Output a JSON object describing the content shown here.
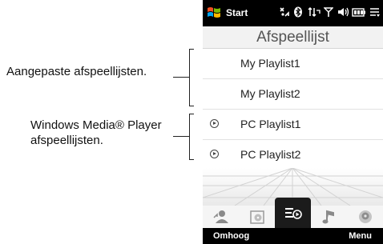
{
  "callouts": {
    "custom": "Aangepaste afspeellijsten.",
    "wmp_line1": "Windows Media® Player",
    "wmp_line2": "afspeellijsten."
  },
  "statusbar": {
    "start_label": "Start",
    "icons": [
      "network-icon",
      "bluetooth-icon",
      "data-connection-icon",
      "signal-icon",
      "volume-icon",
      "battery-icon",
      "menu-icon"
    ]
  },
  "screen": {
    "title": "Afspeellijst",
    "playlists": [
      {
        "label": "My Playlist1",
        "pc": false
      },
      {
        "label": "My Playlist2",
        "pc": false
      },
      {
        "label": "PC Playlist1",
        "pc": true
      },
      {
        "label": "PC Playlist2",
        "pc": true
      }
    ]
  },
  "tabs": [
    {
      "icon": "artists-icon",
      "selected": false
    },
    {
      "icon": "albums-icon",
      "selected": false
    },
    {
      "icon": "playlists-icon",
      "selected": true
    },
    {
      "icon": "songs-icon",
      "selected": false
    },
    {
      "icon": "genres-icon",
      "selected": false
    }
  ],
  "softkeys": {
    "left": "Omhoog",
    "right": "Menu"
  },
  "colors": {
    "bar": "#000000",
    "selected_tab": "#1b1b1b",
    "windows_logo": [
      "#f25022",
      "#7fba00",
      "#00a4ef",
      "#ffb900"
    ]
  }
}
